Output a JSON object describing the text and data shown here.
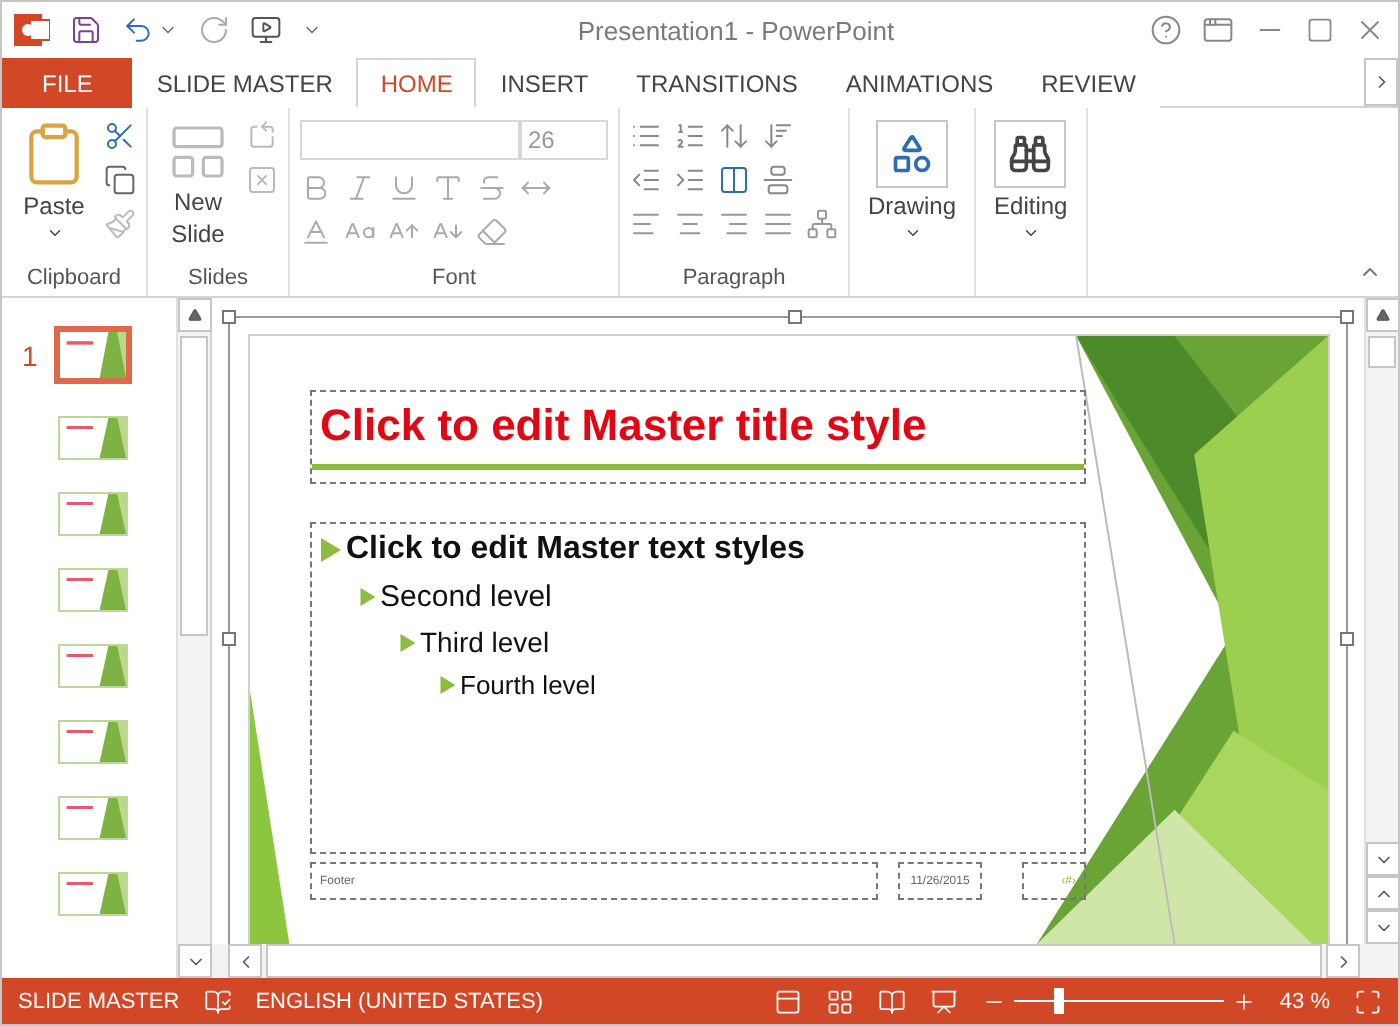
{
  "window": {
    "title": "Presentation1 - PowerPoint"
  },
  "tabs": [
    {
      "label": "FILE",
      "kind": "file",
      "selected": false
    },
    {
      "label": "SLIDE MASTER",
      "kind": "tab",
      "selected": false
    },
    {
      "label": "HOME",
      "kind": "tab",
      "selected": true
    },
    {
      "label": "INSERT",
      "kind": "tab",
      "selected": false
    },
    {
      "label": "TRANSITIONS",
      "kind": "tab",
      "selected": false
    },
    {
      "label": "ANIMATIONS",
      "kind": "tab",
      "selected": false
    },
    {
      "label": "REVIEW",
      "kind": "tab",
      "selected": false
    }
  ],
  "ribbon": {
    "clipboard": {
      "label": "Clipboard",
      "paste": "Paste"
    },
    "slides": {
      "label": "Slides",
      "new_slide": [
        "New",
        "Slide"
      ]
    },
    "font": {
      "label": "Font",
      "font_size": "26"
    },
    "paragraph": {
      "label": "Paragraph"
    },
    "drawing": {
      "label": "Drawing"
    },
    "editing": {
      "label": "Editing"
    }
  },
  "slides_pane": {
    "thumbnails": [
      {
        "number": "1",
        "selected": true
      },
      {
        "selected": false
      },
      {
        "selected": false
      },
      {
        "selected": false
      },
      {
        "selected": false
      },
      {
        "selected": false
      },
      {
        "selected": false
      },
      {
        "selected": false
      }
    ]
  },
  "slide": {
    "title": "Click to edit Master title style",
    "levels": [
      {
        "text": "Click to edit Master text styles",
        "children": [
          {
            "text": "Second level",
            "children": [
              {
                "text": "Third level",
                "children": [
                  {
                    "text": "Fourth level"
                  }
                ]
              }
            ]
          }
        ]
      }
    ],
    "footer": "Footer",
    "date": "11/26/2015",
    "page_number": "‹#›"
  },
  "status_bar": {
    "mode": "SLIDE MASTER",
    "language": "ENGLISH (UNITED STATES)",
    "zoom": {
      "level": 0.21,
      "reading": "43 %"
    }
  }
}
